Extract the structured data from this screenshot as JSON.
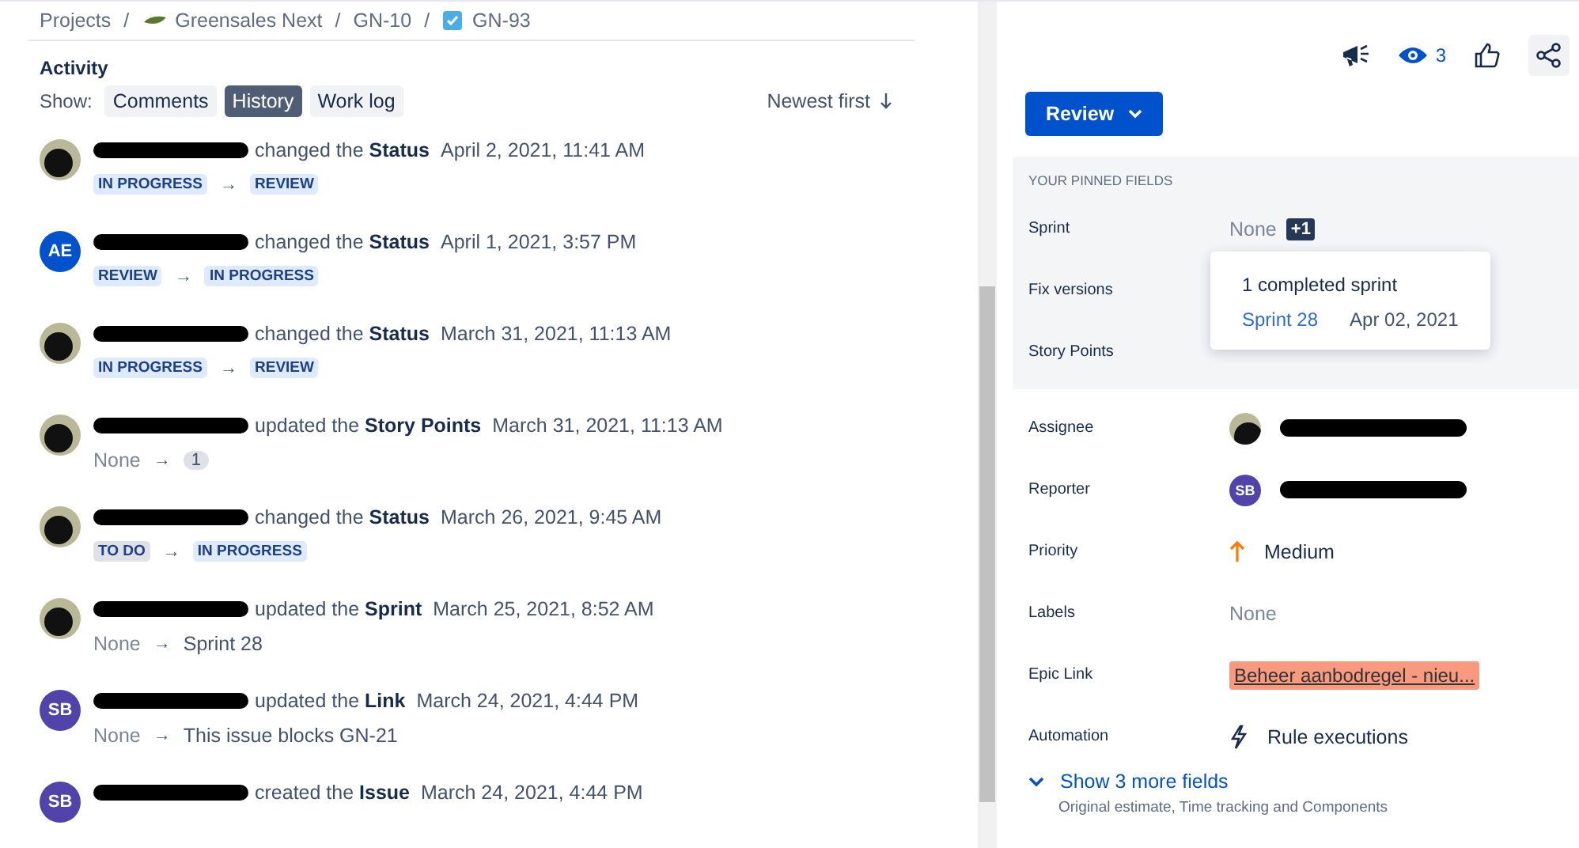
{
  "breadcrumbs": [
    {
      "kind": "text",
      "label": "Projects"
    },
    {
      "kind": "project",
      "separator": "/",
      "label": "Greensales Next"
    },
    {
      "kind": "text",
      "separator": "/",
      "label": "GN-10"
    },
    {
      "kind": "issue",
      "separator": "/",
      "label": "GN-93"
    }
  ],
  "activity": {
    "title": "Activity",
    "show_label": "Show:",
    "filters": [
      {
        "label": "Comments",
        "selected": false
      },
      {
        "label": "History",
        "selected": true
      },
      {
        "label": "Work log",
        "selected": false
      }
    ],
    "sort": "Newest first",
    "entries": [
      {
        "avatar": {
          "kind": "photo"
        },
        "verb": "changed the",
        "field": "Status",
        "time": "April 2, 2021, 11:41 AM",
        "change": {
          "kind": "status",
          "from": {
            "label": "IN PROGRESS",
            "color": "#deebff"
          },
          "arrow": "→",
          "to": {
            "label": "REVIEW",
            "color": "#deebff"
          }
        }
      },
      {
        "avatar": {
          "kind": "initials",
          "initials": "AE",
          "color": "#0052cc"
        },
        "verb": "changed the",
        "field": "Status",
        "time": "April 1, 2021, 3:57 PM",
        "change": {
          "kind": "status",
          "from": {
            "label": "REVIEW",
            "color": "#deebff"
          },
          "arrow": "→",
          "to": {
            "label": "IN PROGRESS",
            "color": "#deebff"
          }
        }
      },
      {
        "avatar": {
          "kind": "photo"
        },
        "verb": "changed the",
        "field": "Status",
        "time": "March 31, 2021, 11:13 AM",
        "change": {
          "kind": "status",
          "from": {
            "label": "IN PROGRESS",
            "color": "#deebff"
          },
          "arrow": "→",
          "to": {
            "label": "REVIEW",
            "color": "#deebff"
          }
        }
      },
      {
        "avatar": {
          "kind": "photo"
        },
        "verb": "updated the",
        "field": "Story Points",
        "time": "March 31, 2021, 11:13 AM",
        "change": {
          "kind": "badge",
          "from": "None",
          "arrow": "→",
          "to": "1"
        }
      },
      {
        "avatar": {
          "kind": "photo"
        },
        "verb": "changed the",
        "field": "Status",
        "time": "March 26, 2021, 9:45 AM",
        "change": {
          "kind": "status",
          "from": {
            "label": "TO DO",
            "color": "#dfe1e6"
          },
          "arrow": "→",
          "to": {
            "label": "IN PROGRESS",
            "color": "#deebff"
          }
        }
      },
      {
        "avatar": {
          "kind": "photo"
        },
        "verb": "updated the",
        "field": "Sprint",
        "time": "March 25, 2021, 8:52 AM",
        "change": {
          "kind": "text",
          "from": "None",
          "arrow": "→",
          "to": "Sprint 28"
        }
      },
      {
        "avatar": {
          "kind": "initials",
          "initials": "SB",
          "color": "#5243aa"
        },
        "verb": "updated the",
        "field": "Link",
        "time": "March 24, 2021, 4:44 PM",
        "change": {
          "kind": "text",
          "from": "None",
          "arrow": "→",
          "to": "This issue blocks GN-21"
        }
      },
      {
        "avatar": {
          "kind": "initials",
          "initials": "SB",
          "color": "#5243aa"
        },
        "verb": "created the",
        "field": "Issue",
        "time": "March 24, 2021, 4:44 PM"
      }
    ]
  },
  "toolbar": {
    "watchers": "3"
  },
  "status_button": "Review",
  "pinned": {
    "title": "YOUR PINNED FIELDS",
    "fields": [
      {
        "label": "Sprint",
        "kind": "sprint",
        "value": "None",
        "extra": "+1"
      },
      {
        "label": "Fix versions",
        "kind": "blank"
      },
      {
        "label": "Story Points",
        "kind": "blank"
      }
    ],
    "popup": {
      "title": "1 completed sprint",
      "sprint": "Sprint 28",
      "date": "Apr 02, 2021"
    }
  },
  "fields": [
    {
      "label": "Assignee",
      "kind": "user",
      "avatar": {
        "kind": "photo"
      }
    },
    {
      "label": "Reporter",
      "kind": "user",
      "avatar": {
        "kind": "initials",
        "initials": "SB",
        "color": "#5243aa"
      }
    },
    {
      "label": "Priority",
      "kind": "priority",
      "value": "Medium"
    },
    {
      "label": "Labels",
      "kind": "none",
      "value": "None"
    },
    {
      "label": "Epic Link",
      "kind": "epic",
      "value": "Beheer aanbodregel - nieu...",
      "color": "#f79a80"
    },
    {
      "label": "Automation",
      "kind": "automation",
      "value": "Rule executions"
    }
  ],
  "more": {
    "label": "Show 3 more fields",
    "hint": "Original estimate, Time tracking and Components"
  }
}
